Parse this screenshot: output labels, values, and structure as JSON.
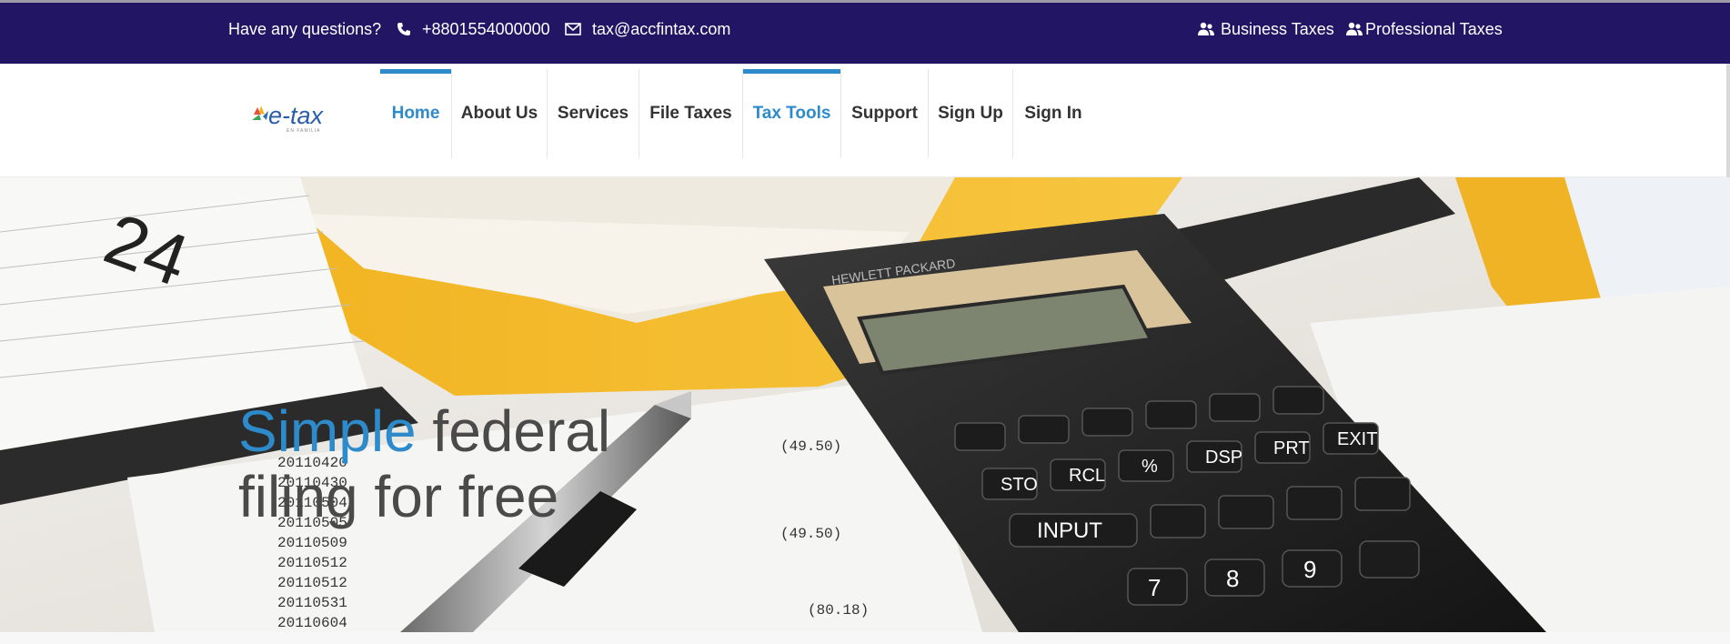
{
  "topbar": {
    "question": "Have any questions?",
    "phone": "+8801554000000",
    "email": "tax@accfintax.com",
    "links": [
      {
        "label": "Business Taxes",
        "icon": "users-icon"
      },
      {
        "label": "Professional Taxes",
        "icon": "users-icon"
      }
    ]
  },
  "brand": {
    "name": "e-tax",
    "tagline": "EN FAMILIA"
  },
  "nav": {
    "items": [
      {
        "label": "Home",
        "active": true
      },
      {
        "label": "About Us"
      },
      {
        "label": "Services"
      },
      {
        "label": "File Taxes"
      },
      {
        "label": "Tax Tools",
        "active": true
      },
      {
        "label": "Support"
      },
      {
        "label": "Sign Up"
      },
      {
        "label": "Sign In"
      }
    ]
  },
  "hero": {
    "title_accent": "Simple",
    "title_rest": " federal",
    "title_line2": "filing for free"
  },
  "colors": {
    "topbar_bg": "#221564",
    "accent": "#2d8acb",
    "nav_text": "#333333"
  }
}
